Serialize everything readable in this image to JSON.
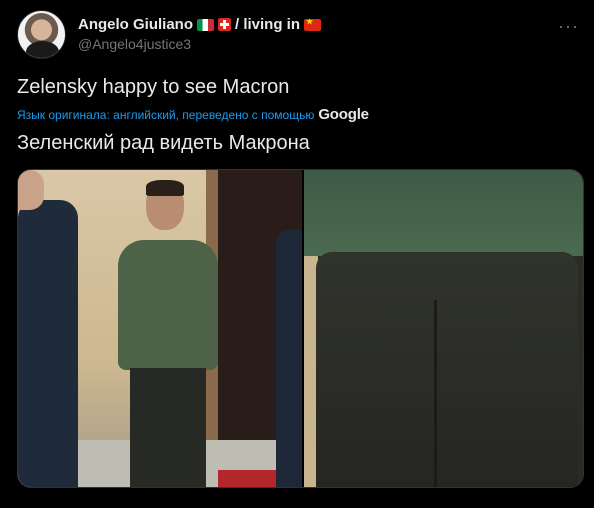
{
  "header": {
    "display_name": "Angelo Giuliano",
    "living_text": "/ living in",
    "handle": "@Angelo4justice3",
    "flags": [
      "italy-flag-icon",
      "switzerland-flag-icon",
      "china-flag-icon"
    ]
  },
  "tweet": {
    "text": "Zelensky happy to see Macron",
    "translation_note": "Язык оригинала: английский, переведено с помощью",
    "translation_provider": "Google",
    "translated_text": "Зеленский рад видеть Макрона"
  },
  "colors": {
    "background": "#000000",
    "text": "#e7e9ea",
    "secondary": "#71767b",
    "accent": "#1d9bf0"
  }
}
